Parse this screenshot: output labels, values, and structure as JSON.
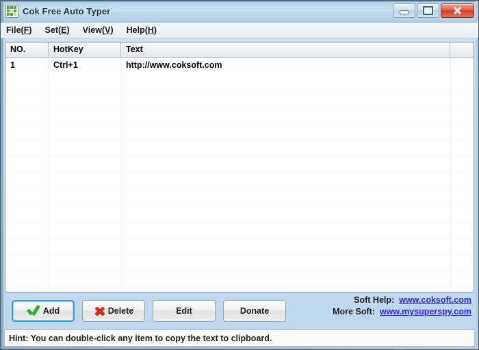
{
  "window": {
    "title": "Cok Free Auto Typer",
    "icon": "keyboard-grid-icon",
    "buttons": {
      "minimize": "minimize-icon",
      "maximize": "maximize-icon",
      "close": "close-icon"
    }
  },
  "menubar": {
    "items": [
      {
        "label": "File",
        "accel": "F"
      },
      {
        "label": "Set",
        "accel": "E"
      },
      {
        "label": "View",
        "accel": "V"
      },
      {
        "label": "Help",
        "accel": "H"
      }
    ]
  },
  "list": {
    "columns": [
      "NO.",
      "HotKey",
      "Text",
      ""
    ],
    "rows": [
      {
        "no": "1",
        "hotkey": "Ctrl+1",
        "text": "http://www.coksoft.com",
        "extra": ""
      }
    ]
  },
  "toolbar": {
    "add_label": "Add",
    "delete_label": "Delete",
    "edit_label": "Edit",
    "donate_label": "Donate"
  },
  "links": {
    "soft_help_label": "Soft Help:",
    "soft_help_url": "www.coksoft.com",
    "more_soft_label": "More Soft:",
    "more_soft_url": "www.mysuperspy.com"
  },
  "statusbar": {
    "hint": "Hint: You can double-click any item to copy the text to clipboard."
  },
  "colors": {
    "titlebar_accent": "#b9d4ea",
    "close_button": "#cf4229",
    "link": "#3225e8",
    "check_green": "#2bb02b",
    "delete_red": "#d42a1c",
    "focus_border": "#3f9bd4"
  }
}
